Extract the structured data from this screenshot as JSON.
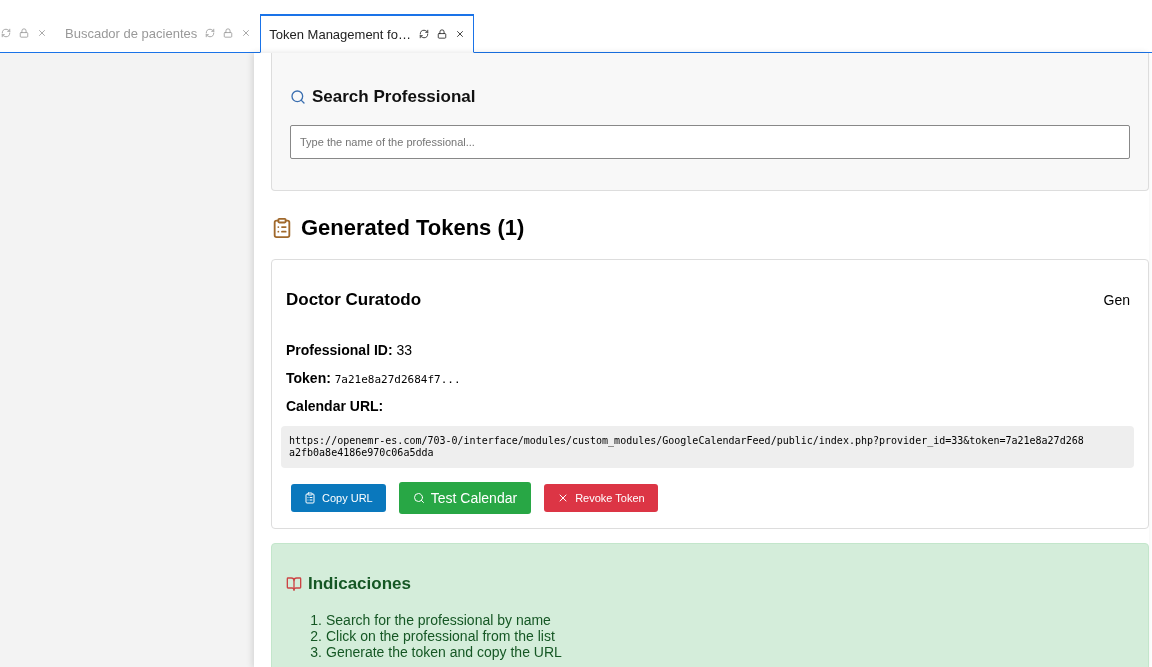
{
  "tabs": [
    {
      "selected": false
    },
    {
      "label": "Buscador de pacientes",
      "selected": false
    },
    {
      "label": "Token Management fo…",
      "selected": true
    }
  ],
  "search": {
    "title": "Search Professional",
    "placeholder": "Type the name of the professional..."
  },
  "tokens": {
    "title": "Generated Tokens (1)",
    "items": [
      {
        "name": "Doctor Curatodo",
        "generated": "Gen",
        "professional_id_label": "Professional ID:",
        "professional_id": "33",
        "token_label": "Token:",
        "token": "7a21e8a27d2684f7...",
        "url_label": "Calendar URL:",
        "url_lines": [
          "https://openemr-es.com/703-0/interface/modules/custom_modules/GoogleCalendarFeed/public/index.php?provider_id=33&token=7a21e8a27d268",
          "a2fb0a8e4186e970c06a5dda"
        ],
        "buttons": [
          {
            "kind": "copy",
            "label": "Copy URL"
          },
          {
            "kind": "test",
            "label": "Test Calendar"
          },
          {
            "kind": "revoke",
            "label": "Revoke Token"
          }
        ]
      }
    ]
  },
  "instructions": {
    "title": "Indicaciones",
    "steps": [
      {
        "number": "1.",
        "text": "Search for the professional by name"
      },
      {
        "number": "2.",
        "text": "Click on the professional from the list"
      },
      {
        "number": "3.",
        "text": "Generate the token and copy the URL"
      }
    ]
  }
}
